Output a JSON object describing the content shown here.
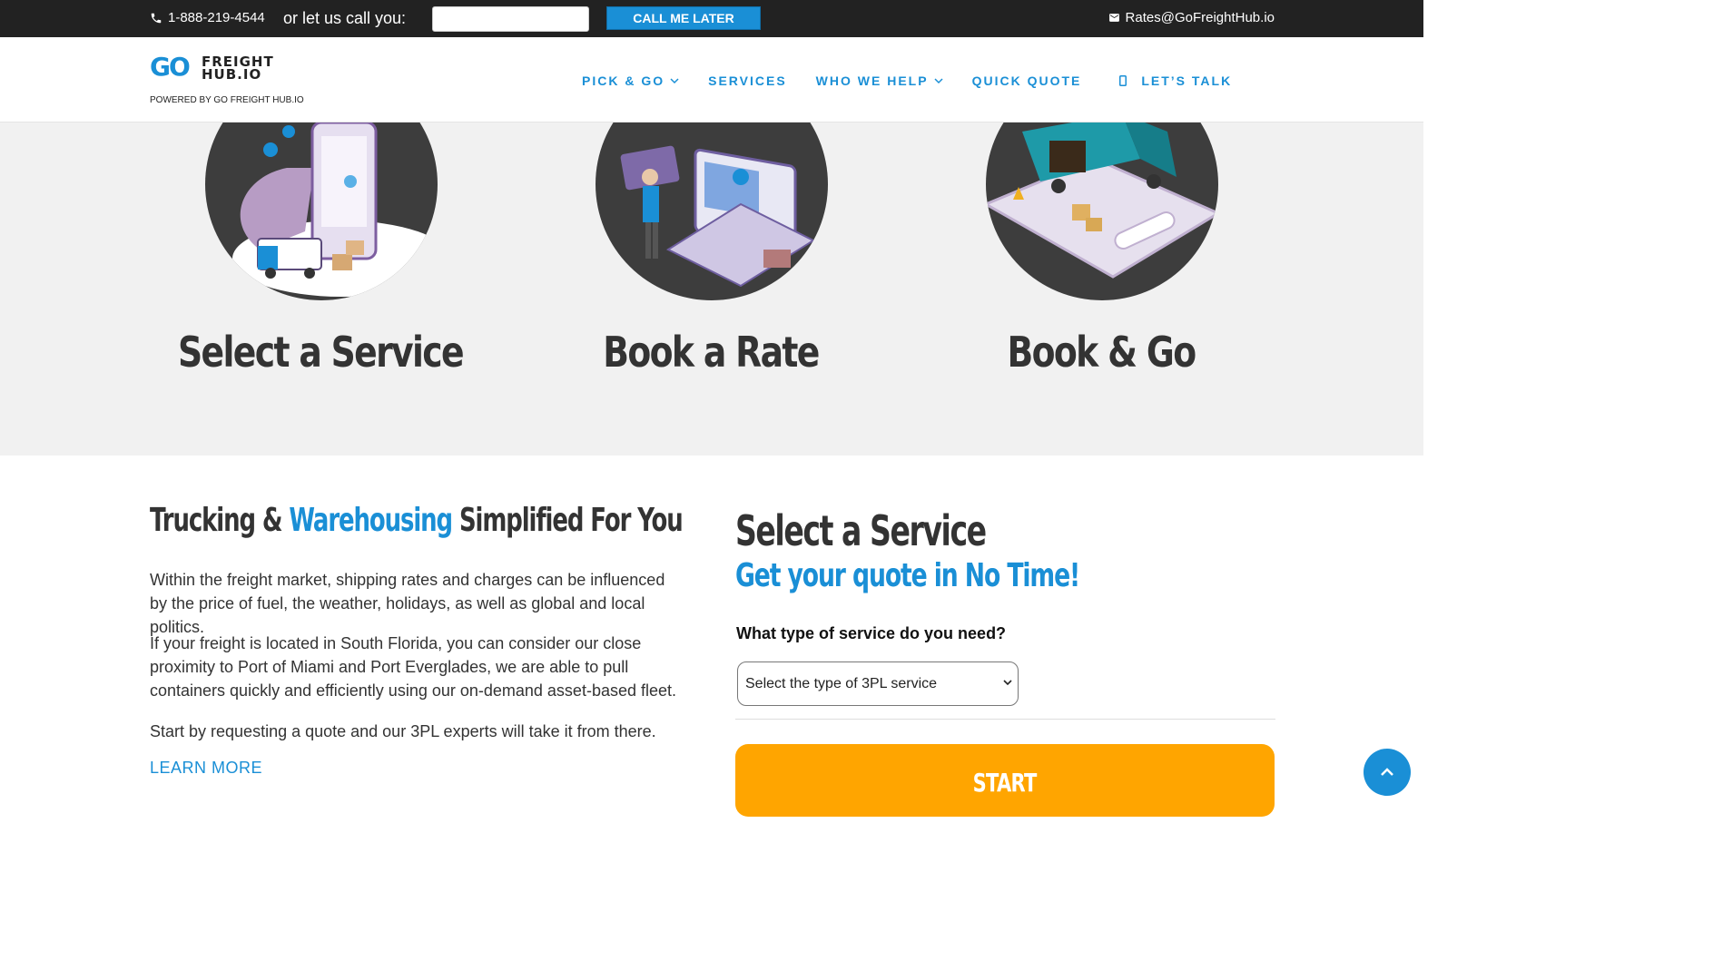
{
  "topbar": {
    "phone": "1-888-219-4544",
    "call_prompt": "or let us call you:",
    "call_input_value": "",
    "call_button": "CALL ME LATER",
    "email": "Rates@GoFreightHub.io"
  },
  "header": {
    "logo_go": "GO",
    "logo_line1": "FREIGHT",
    "logo_line2": "HUB.IO",
    "powered_by": "POWERED BY GO FREIGHT HUB.IO",
    "nav": {
      "pick_go": "PICK & GO",
      "services": "SERVICES",
      "who_we_help": "WHO WE HELP",
      "quick_quote": "QUICK QUOTE",
      "lets_talk": "LET’S TALK"
    }
  },
  "steps": {
    "step1": "Select a Service",
    "step2": "Book a Rate",
    "step3": "Book & Go"
  },
  "content": {
    "headline_pre": "Trucking & ",
    "headline_accent": "Warehousing",
    "headline_post": " Simplified For You",
    "p1": "Within the freight market, shipping rates and charges can be influenced by the price of fuel, the weather, holidays, as well as global and local politics.",
    "p2": "If your freight is located in South Florida, you can consider our close proximity to Port of Miami and Port Everglades, we are able to pull containers quickly and efficiently using our on-demand asset-based fleet.",
    "p3": "Start by requesting a quote and our 3PL experts will take it from there.",
    "learn_more": "LEARN MORE"
  },
  "form": {
    "title": "Select a Service",
    "subtitle": "Get your quote in No Time!",
    "question": "What type of service do you need?",
    "select_value": "Select the type of 3PL service",
    "start_button": "START"
  },
  "colors": {
    "accent": "#1a8fd6",
    "start": "#ffa500",
    "topbar": "#222222",
    "band": "#f1f1f1"
  }
}
